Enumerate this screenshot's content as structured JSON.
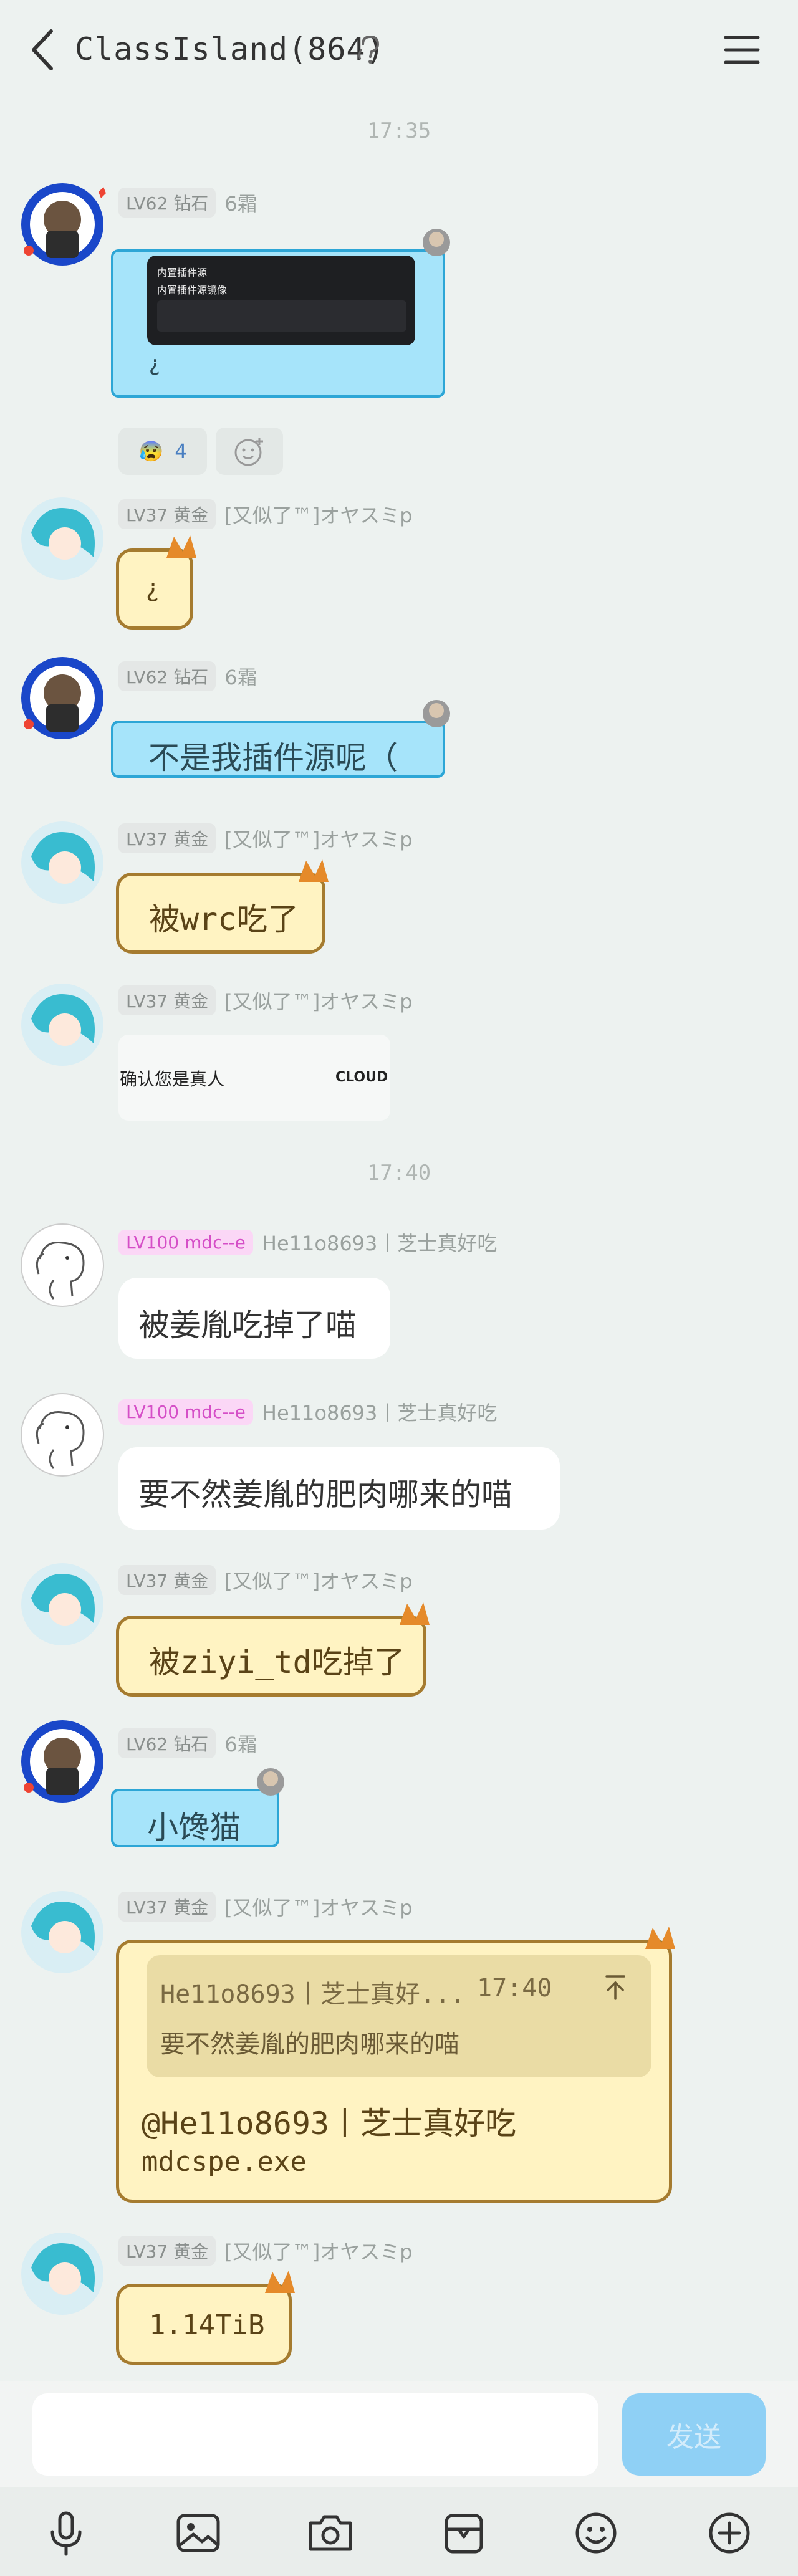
{
  "header": {
    "title": "ClassIsland(864)"
  },
  "times": [
    "17:35",
    "17:40"
  ],
  "users": {
    "u62": {
      "level": "LV62 钻石",
      "nick": "6霜"
    },
    "u37": {
      "level": "LV37 黄金",
      "nick": "[又似了™]オヤスミp"
    },
    "u100": {
      "level": "LV100 mdc--e",
      "nick": "He11o8693丨芝士真好吃"
    }
  },
  "messages": [
    {
      "id": "m1",
      "image_lines": [
        "内置插件源",
        "内置插件源镜像"
      ],
      "text": "¿",
      "reaction": {
        "emoji": "😰",
        "count": "4"
      }
    },
    {
      "id": "m2",
      "text": "¿"
    },
    {
      "id": "m3",
      "text": "不是我插件源呢（"
    },
    {
      "id": "m4",
      "text": "被wrc吃了"
    },
    {
      "id": "m5",
      "image_texts": [
        "确认您是真人",
        "CLOUD"
      ]
    },
    {
      "id": "m6",
      "text": "被姜胤吃掉了喵"
    },
    {
      "id": "m7",
      "text": "要不然姜胤的肥肉哪来的喵"
    },
    {
      "id": "m8",
      "text": "被ziyi_td吃掉了"
    },
    {
      "id": "m9",
      "text": "小馋猫"
    },
    {
      "id": "m10",
      "quote": {
        "author": "He11o8693丨芝士真好...",
        "time": "17:40",
        "text": "要不然姜胤的肥肉哪来的喵"
      },
      "text_line1": "@He11o8693丨芝士真好吃",
      "text_line2": "mdcspe.exe"
    },
    {
      "id": "m11",
      "text": "1.14TiB"
    }
  ],
  "input": {
    "send_label": "发送"
  },
  "toolbar": [
    "mic-icon",
    "image-icon",
    "camera-icon",
    "gift-icon",
    "emoji-icon",
    "plus-icon"
  ]
}
